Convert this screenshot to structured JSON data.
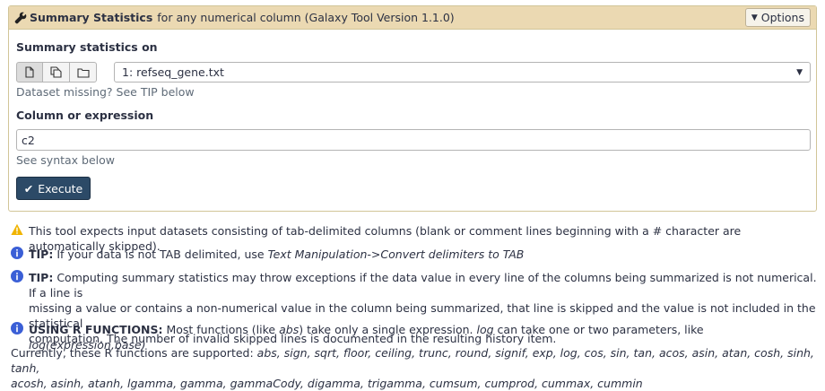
{
  "header": {
    "tool_name": "Summary Statistics",
    "description": "for any numerical column (Galaxy Tool Version 1.1.0)",
    "options_label": "Options",
    "wrench_icon": "wrench-icon"
  },
  "form": {
    "input1": {
      "label": "Summary statistics on",
      "source_buttons": [
        "single-dataset-icon",
        "multiple-datasets-icon",
        "folder-icon"
      ],
      "selected_value": "1: refseq_gene.txt",
      "help": "Dataset missing? See TIP below"
    },
    "column": {
      "label": "Column or expression",
      "value": "c2",
      "help": "See syntax below"
    },
    "execute_label": "Execute"
  },
  "help_text": {
    "warning": "This tool expects input datasets consisting of tab-delimited columns (blank or comment lines beginning with a # character are automatically skipped).",
    "tip1_bold": "TIP:",
    "tip1_text": "If your data is not TAB delimited, use",
    "tip1_italic": "Text Manipulation->Convert delimiters to TAB",
    "tip2_bold": "TIP:",
    "tip2_line1": "Computing summary statistics may throw exceptions if the data value in every line of the columns being summarized is not numerical. If a line is",
    "tip2_line2": "missing a value or contains a non-numerical value in the column being summarized, that line is skipped and the value is not included in the statistical",
    "tip2_line3": "computation. The number of invalid skipped lines is documented in the resulting history item.",
    "rfunc_bold": "USING R FUNCTIONS:",
    "rfunc_a": "Most functions (like",
    "rfunc_abs": "abs",
    "rfunc_b": ") take only a single expression.",
    "rfunc_log": "log",
    "rfunc_c": "can take one or two parameters, like",
    "rfunc_example": "log(expression,base)",
    "supported_lead": "Currently, these R functions are supported:",
    "supported_line1": "abs, sign, sqrt, floor, ceiling, trunc, round, signif, exp, log, cos, sin, tan, acos, asin, atan, cosh, sinh, tanh,",
    "supported_line2": "acosh, asinh, atanh, lgamma, gamma, gammaCody, digamma, trigamma, cumsum, cumprod, cummax, cummin"
  },
  "colors": {
    "header_bg": "#ebd9b2",
    "execute_bg": "#2c4a67",
    "info_blue": "#3b5fd6",
    "warning_yellow": "#f0b400"
  }
}
